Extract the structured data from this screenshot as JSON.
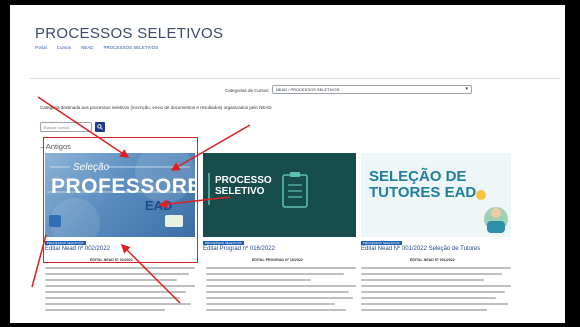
{
  "page": {
    "title": "PROCESSOS SELETIVOS",
    "breadcrumb": [
      "Portal",
      "Cursos",
      "NEAD",
      "PROCESSOS SELETIVOS"
    ]
  },
  "filter": {
    "category_label": "Categorias de Cursos",
    "category_value": "NEAD / PROCESSOS SELETIVOS"
  },
  "intro": "Categoria destinada aos processos seletivos (inscrição, envio de documentos e resultados) organizados pelo NEAD",
  "search": {
    "placeholder": "Buscar cursos"
  },
  "section": {
    "heading": "Antigos"
  },
  "cards": [
    {
      "image_title": "PROFESSORES",
      "image_sub": "Seleção",
      "image_ead": "EAD",
      "badge": "PROCESSOS SELETIVOS",
      "title": "Edital Nead nº 002/2022",
      "subtitle": "EDITAL NEAD Nº 02/2022",
      "desc": "PROCESSO SIMPLIFICADO DESTINADO À SELEÇÃO DE PROFESSORES BOLSISTAS PARA EDUCAÇÃO A DISTÂNCIA BEM COMO FORMAÇÃO DE CADASTRO DE RESERVA PARA PROFESSORES BOLSISTAS NESSA MODALIDADE"
    },
    {
      "image_title": "PROCESSO SELETIVO",
      "badge": "PROCESSOS SELETIVOS",
      "title": "Edital Prograd nº 016/2022",
      "subtitle": "EDITAL PROGRAD Nº 16/2022",
      "desc": "PROCESSO SIMPLIFICADO PARA INSCRIÇÃO DE ALUNOS PARA OS CURSOS DE LICENCIATURA EM FÍSICA E MATEMÁTICA NA MODALIDADE DE EDUCAÇÃO A DISTÂNCIA 2022"
    },
    {
      "image_title": "SELEÇÃO DE TUTORES EAD",
      "badge": "PROCESSOS SELETIVOS",
      "title": "Edital Nead Nº 001/2022 Seleção de Tutores",
      "subtitle": "EDITAL NEAD Nº 001/2022",
      "desc": "PROCESSO SIMPLIFICADO DESTINADO À SELEÇÃO DE TUTORES BOLSISTAS PARA A EDUCAÇÃO A DISTÂNCIA BEM COMO FORMAÇÃO DE CADASTRO DE RESERVA PARA TUTORES BOLSISTAS"
    }
  ],
  "colors": {
    "accent": "#1f3a8a",
    "annotation": "#e02020"
  }
}
